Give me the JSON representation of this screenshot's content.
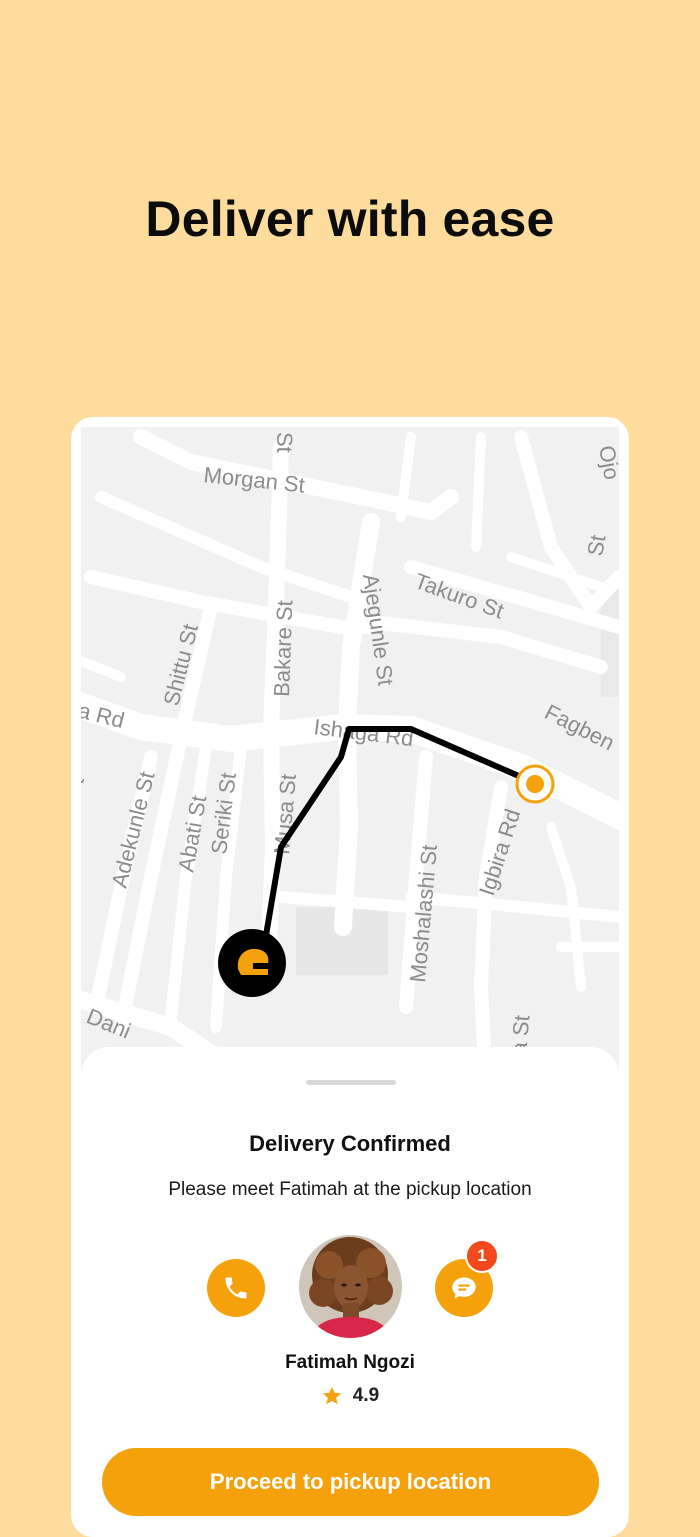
{
  "hero": {
    "title": "Deliver with ease"
  },
  "map": {
    "streets": [
      "Morgan St",
      "St",
      "Ojo",
      "St",
      "Takuro St",
      "Shittu St",
      "Bakare St",
      "Ajegunle St",
      "a Rd",
      "Ishaga Rd",
      "Fagben",
      "Adekunle St",
      "Abati St",
      "Seriki St",
      "Musa St",
      "Moshalashi St",
      "Igbira Rd",
      "Dani",
      "ira St",
      "t"
    ],
    "courier_marker_icon": "helmet-icon",
    "destination_marker_icon": "location-target-icon",
    "accent_color": "#F5A10B"
  },
  "sheet": {
    "title": "Delivery Confirmed",
    "subtitle": "Please meet Fatimah at the pickup location",
    "call_icon": "phone-icon",
    "chat_icon": "chat-icon",
    "unread_count": "1",
    "courier": {
      "name": "Fatimah Ngozi",
      "rating": "4.9",
      "rating_icon": "star-icon"
    },
    "cta_label": "Proceed to pickup location"
  },
  "colors": {
    "background": "#FEDC9D",
    "accent": "#F5A10B",
    "badge": "#F24A1C"
  }
}
